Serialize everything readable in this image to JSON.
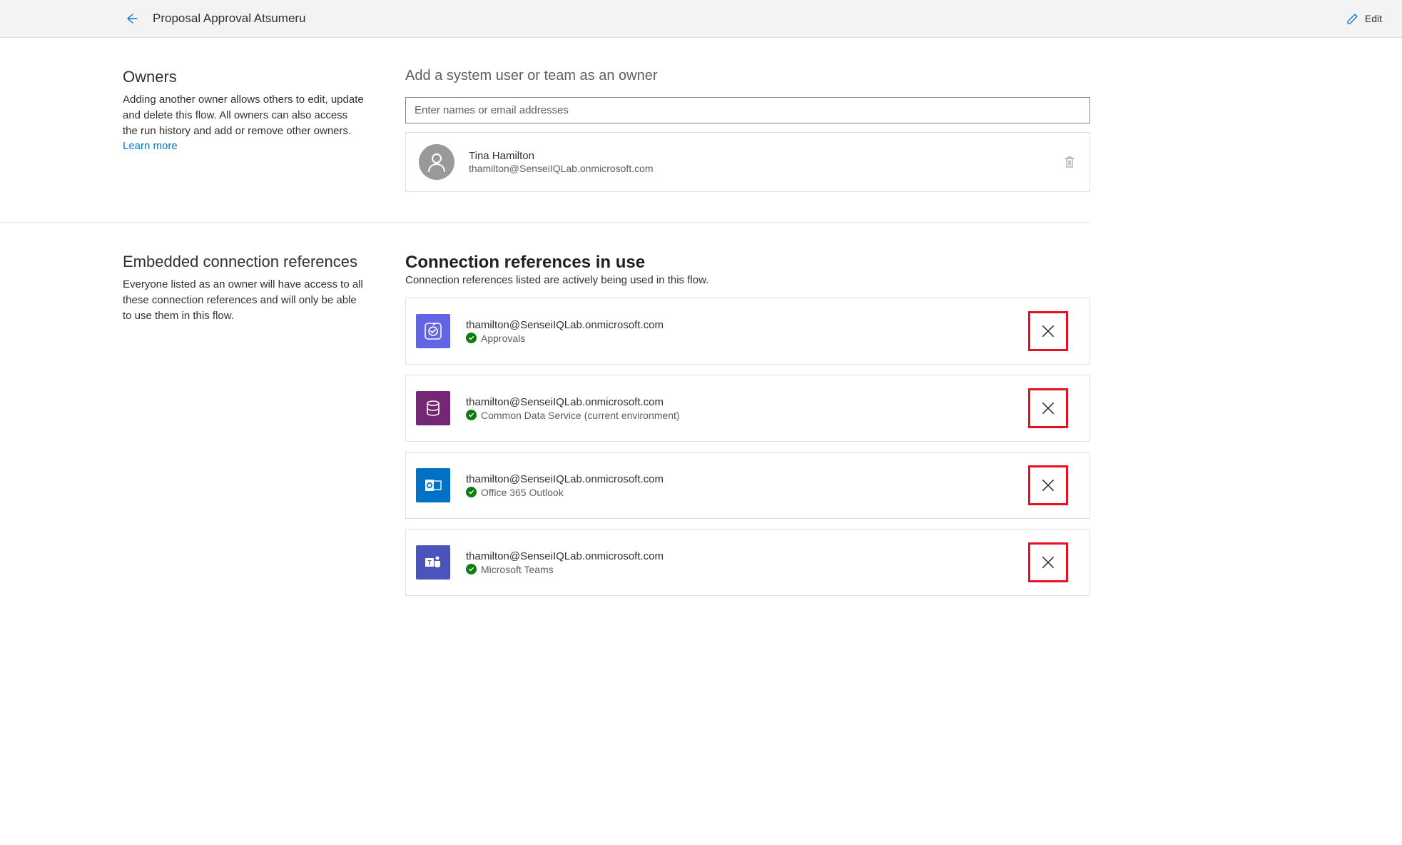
{
  "header": {
    "title": "Proposal Approval Atsumeru",
    "edit_label": "Edit"
  },
  "owners": {
    "heading": "Owners",
    "description": "Adding another owner allows others to edit, update and delete this flow. All owners can also access the run history and add or remove other owners.",
    "learn_more": "Learn more",
    "subheading": "Add a system user or team as an owner",
    "input_placeholder": "Enter names or email addresses",
    "list": [
      {
        "name": "Tina Hamilton",
        "email": "thamilton@SenseiIQLab.onmicrosoft.com"
      }
    ]
  },
  "connections": {
    "heading_left": "Embedded connection references",
    "description_left": "Everyone listed as an owner will have access to all these connection references and will only be able to use them in this flow.",
    "heading_right": "Connection references in use",
    "subdesc_right": "Connection references listed are actively being used in this flow.",
    "items": [
      {
        "email": "thamilton@SenseiIQLab.onmicrosoft.com",
        "service": "Approvals",
        "icon": "approvals"
      },
      {
        "email": "thamilton@SenseiIQLab.onmicrosoft.com",
        "service": "Common Data Service (current environment)",
        "icon": "cds"
      },
      {
        "email": "thamilton@SenseiIQLab.onmicrosoft.com",
        "service": "Office 365 Outlook",
        "icon": "outlook"
      },
      {
        "email": "thamilton@SenseiIQLab.onmicrosoft.com",
        "service": "Microsoft Teams",
        "icon": "teams"
      }
    ]
  }
}
